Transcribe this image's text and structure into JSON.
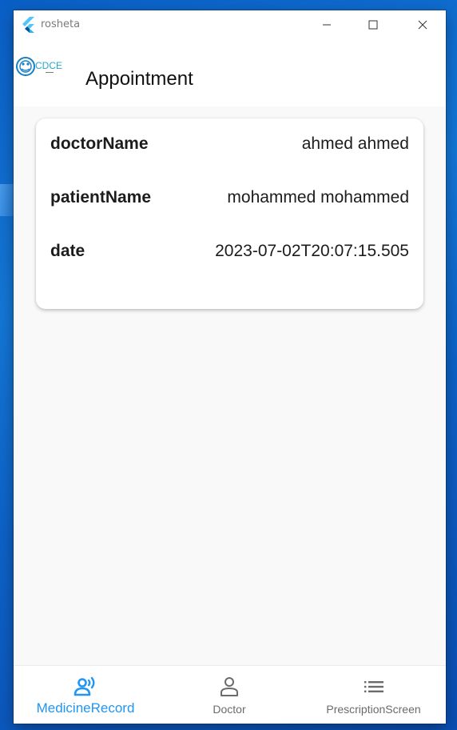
{
  "window": {
    "title": "rosheta"
  },
  "appbar": {
    "logo_text": "CDCE",
    "title": "Appointment"
  },
  "appointment": {
    "rows": [
      {
        "label": "doctorName",
        "value": "ahmed ahmed"
      },
      {
        "label": "patientName",
        "value": "mohammed mohammed"
      },
      {
        "label": "date",
        "value": "2023-07-02T20:07:15.505"
      }
    ]
  },
  "bottom_nav": {
    "items": [
      {
        "label": "MedicineRecord",
        "icon": "record-voice-icon",
        "selected": true
      },
      {
        "label": "Doctor",
        "icon": "person-icon",
        "selected": false
      },
      {
        "label": "PrescriptionScreen",
        "icon": "list-icon",
        "selected": false
      }
    ],
    "active_color": "#2196f3",
    "inactive_color": "#6b6b6b"
  }
}
